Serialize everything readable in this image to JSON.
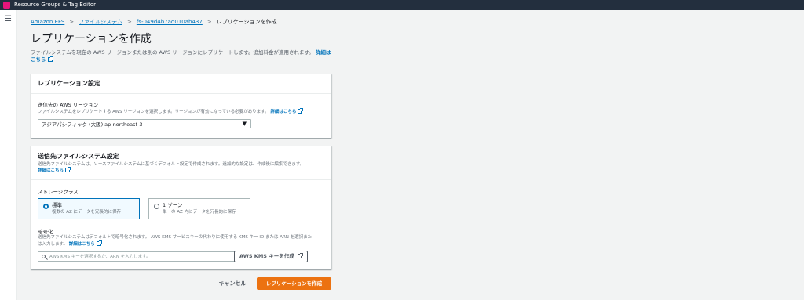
{
  "topbar": {
    "service_name": "Resource Groups & Tag Editor"
  },
  "breadcrumb": [
    {
      "label": "Amazon EFS"
    },
    {
      "label": "ファイルシステム"
    },
    {
      "label": "fs-049d4b7ad010ab437"
    },
    {
      "label": "レプリケーションを作成"
    }
  ],
  "page": {
    "title": "レプリケーションを作成",
    "description": "ファイルシステムを現在の AWS リージョンまたは別の AWS リージョンにレプリケートします。追加料金が適用されます。",
    "details_link": "詳細はこちら"
  },
  "replication_settings": {
    "title": "レプリケーション設定",
    "region_label": "送信先の AWS リージョン",
    "region_help": "ファイルシステムをレプリケートする AWS リージョンを選択します。リージョンが有効になっている必要があります。",
    "region_help_link": "詳細はこちら",
    "region_value": "アジアパシフィック (大阪) ap-northeast-3"
  },
  "destination_settings": {
    "title": "送信先ファイルシステム設定",
    "description": "送信先ファイルシステムは、ソースファイルシステムに基づくデフォルト設定で作成されます。追加的な設定は、作成後に編集できます。",
    "details_link": "詳細はこちら",
    "storage_class_label": "ストレージクラス",
    "storage_options": [
      {
        "title": "標準",
        "desc": "複数の AZ にデータを冗長的に保存",
        "selected": true
      },
      {
        "title": "1 ゾーン",
        "desc": "単一の AZ 内にデータを冗長的に保存",
        "selected": false
      }
    ],
    "encryption_label": "暗号化",
    "encryption_help_1": "送信先ファイルシステムはデフォルトで暗号化されます。 AWS KMS サービスキーの代わりに使用する KMS キー ID または ARN を選択また",
    "encryption_help_2": "は入力します。",
    "encryption_help_link": "詳細はこちら",
    "kms_placeholder": "AWS KMS キーを選択するか、ARN を入力します。",
    "kms_create_button": "AWS KMS キーを作成"
  },
  "footer": {
    "cancel_label": "キャンセル",
    "submit_label": "レプリケーションを作成"
  },
  "colors": {
    "primary": "#ec7211",
    "link": "#0073bb",
    "topbar": "#232f3e"
  }
}
